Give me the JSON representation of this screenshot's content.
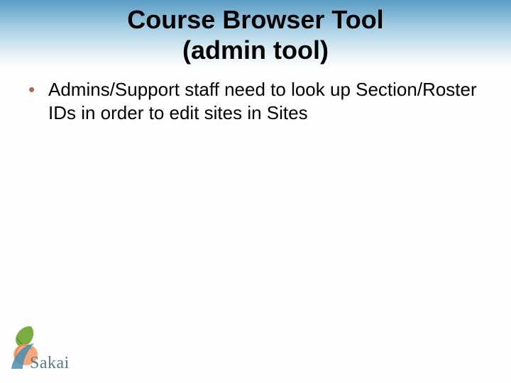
{
  "title_line1": "Course Browser Tool",
  "title_line2": "(admin tool)",
  "bullets": {
    "item0": "Admins/Support staff need to look up Section/Roster IDs in order to edit sites in Sites"
  },
  "logo_text": "Sakai"
}
